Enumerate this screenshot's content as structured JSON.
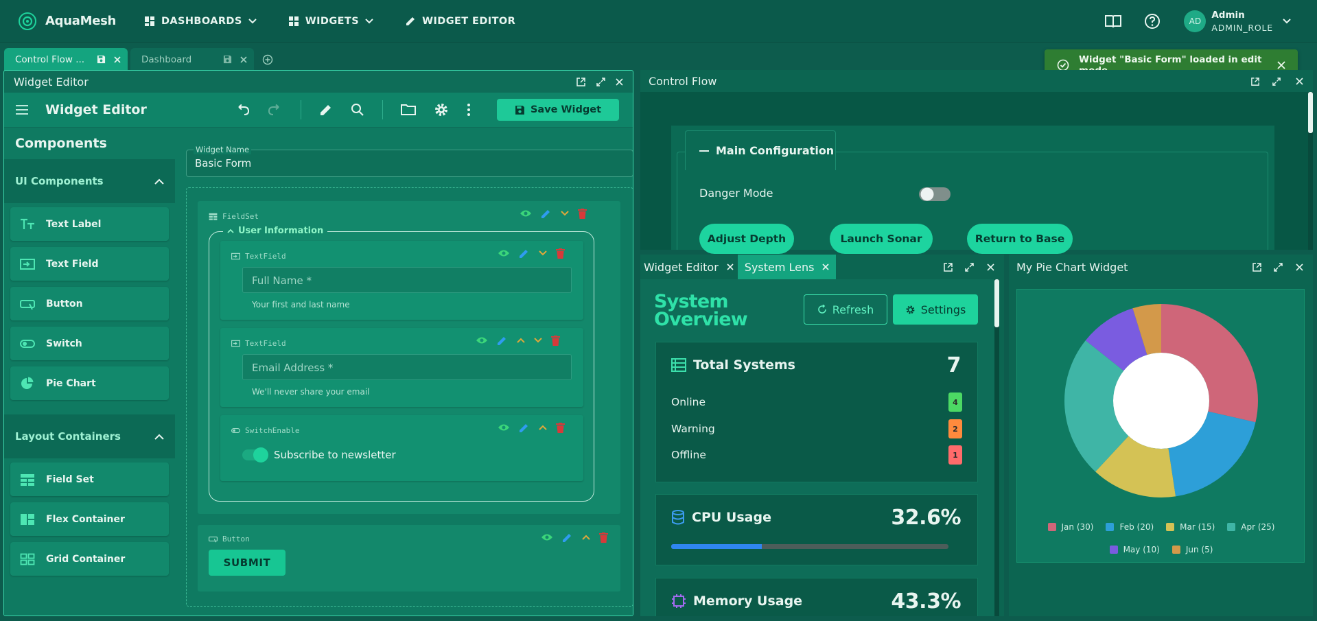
{
  "nav": {
    "brand": "AquaMesh",
    "items": [
      "DASHBOARDS",
      "WIDGETS",
      "WIDGET EDITOR"
    ],
    "user_initials": "AD",
    "user_name": "Admin",
    "user_role": "ADMIN_ROLE"
  },
  "tabs": {
    "active_label": "Control Flow ...",
    "inactive_label": "Dashboard"
  },
  "toast": {
    "message": "Widget \"Basic Form\" loaded in edit mode"
  },
  "editor": {
    "panel_title": "Widget Editor",
    "toolbar_title": "Widget Editor",
    "save_label": "Save Widget",
    "components_title": "Components",
    "ui_section": "UI Components",
    "ui_items": [
      "Text Label",
      "Text Field",
      "Button",
      "Switch",
      "Pie Chart"
    ],
    "layout_section": "Layout Containers",
    "layout_items": [
      "Field Set",
      "Flex Container",
      "Grid Container"
    ],
    "widget_name_label": "Widget Name",
    "widget_name_value": "Basic Form",
    "fieldset_tag": "FieldSet",
    "fieldset_legend": "User Information",
    "textfield_tag": "TextField",
    "field1_placeholder": "Full Name *",
    "field1_help": "Your first and last name",
    "field2_placeholder": "Email Address *",
    "field2_help": "We'll never share your email",
    "switch_tag": "SwitchEnable",
    "switch_label": "Subscribe to newsletter",
    "button_tag": "Button",
    "submit_label": "SUBMIT"
  },
  "control_flow": {
    "title": "Control Flow",
    "section": "Main Configuration",
    "danger_label": "Danger Mode",
    "danger_on": false,
    "buttons": [
      "Adjust Depth",
      "Launch Sonar",
      "Return to Base"
    ]
  },
  "system_lens": {
    "tabs": [
      "Widget Editor",
      "System Lens"
    ],
    "title_line1": "System",
    "title_line2": "Overview",
    "refresh_label": "Refresh",
    "settings_label": "Settings",
    "total_label": "Total Systems",
    "total_value": "7",
    "statuses": [
      {
        "label": "Online",
        "count": "4",
        "color": "#4cd964"
      },
      {
        "label": "Warning",
        "count": "2",
        "color": "#ff8a3d"
      },
      {
        "label": "Offline",
        "count": "1",
        "color": "#ff6b6b"
      }
    ],
    "cpu_label": "CPU Usage",
    "cpu_value": "32.6%",
    "cpu_fraction": 0.326,
    "mem_label": "Memory Usage",
    "mem_value": "43.3%"
  },
  "pie": {
    "title": "My Pie Chart Widget"
  },
  "chart_data": {
    "type": "pie",
    "donut": true,
    "categories": [
      "Jan",
      "Feb",
      "Mar",
      "Apr",
      "May",
      "Jun"
    ],
    "values": [
      30,
      20,
      15,
      25,
      10,
      5
    ],
    "legend": [
      "Jan (30)",
      "Feb (20)",
      "Mar (15)",
      "Apr (25)",
      "May (10)",
      "Jun (5)"
    ],
    "colors": [
      "#cf6679",
      "#2d9fd8",
      "#d4c255",
      "#3fb5a6",
      "#7a5ce0",
      "#d3994a"
    ],
    "legend_position": "bottom"
  }
}
